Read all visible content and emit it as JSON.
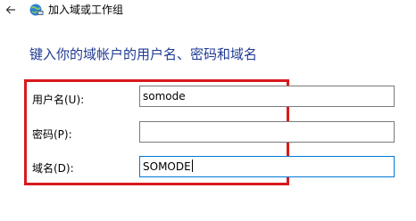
{
  "window": {
    "title": "加入域或工作组"
  },
  "heading": "键入你的域帐户的用户名、密码和域名",
  "fields": {
    "username": {
      "label": "用户名(U):",
      "value": "somode"
    },
    "password": {
      "label": "密码(P):",
      "value": ""
    },
    "domain": {
      "label": "域名(D):",
      "value": "SOMODE"
    }
  },
  "colors": {
    "heading": "#1f3a93",
    "highlight": "#d9191c",
    "focus_border": "#0078d7"
  },
  "icons": {
    "back": "back-arrow-icon",
    "app": "network-globe-icon"
  }
}
